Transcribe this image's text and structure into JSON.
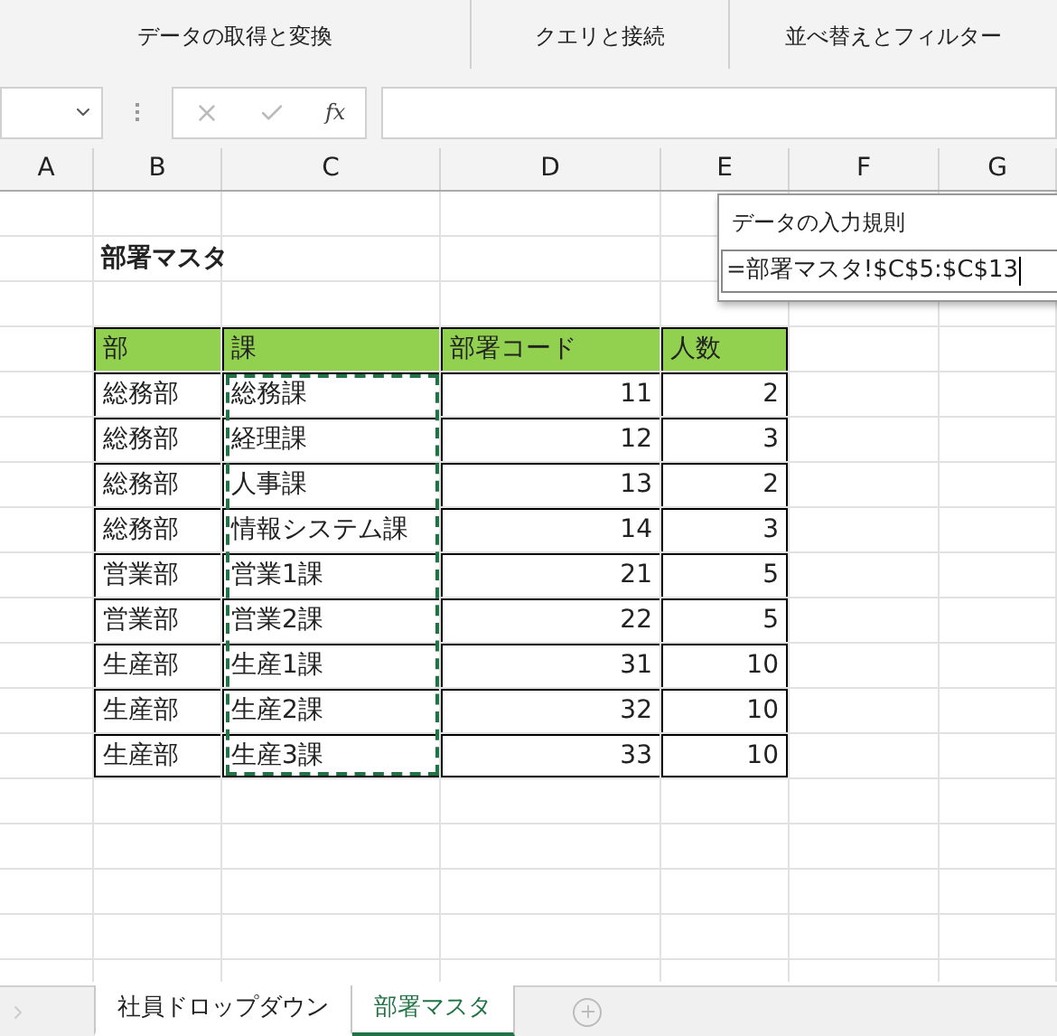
{
  "ribbon": {
    "groups": [
      "データの取得と変換",
      "クエリと接続",
      "並べ替えとフィルター"
    ]
  },
  "formula_bar": {
    "function_label": "fx"
  },
  "column_headers": [
    "A",
    "B",
    "C",
    "D",
    "E",
    "F",
    "G"
  ],
  "sheet_title": "部署マスタ",
  "table": {
    "columns": [
      "部",
      "課",
      "部署コード",
      "人数"
    ],
    "rows": [
      [
        "総務部",
        "総務課",
        "11",
        "2"
      ],
      [
        "総務部",
        "経理課",
        "12",
        "3"
      ],
      [
        "総務部",
        "人事課",
        "13",
        "2"
      ],
      [
        "総務部",
        "情報システム課",
        "14",
        "3"
      ],
      [
        "営業部",
        "営業1課",
        "21",
        "5"
      ],
      [
        "営業部",
        "営業2課",
        "22",
        "5"
      ],
      [
        "生産部",
        "生産1課",
        "31",
        "10"
      ],
      [
        "生産部",
        "生産2課",
        "32",
        "10"
      ],
      [
        "生産部",
        "生産3課",
        "33",
        "10"
      ]
    ]
  },
  "validation_popup": {
    "title": "データの入力規則",
    "value": "=部署マスタ!$C$5:$C$13"
  },
  "sheet_tabs": [
    {
      "label": "社員ドロップダウン",
      "selected": false
    },
    {
      "label": "部署マスタ",
      "selected": true
    }
  ]
}
